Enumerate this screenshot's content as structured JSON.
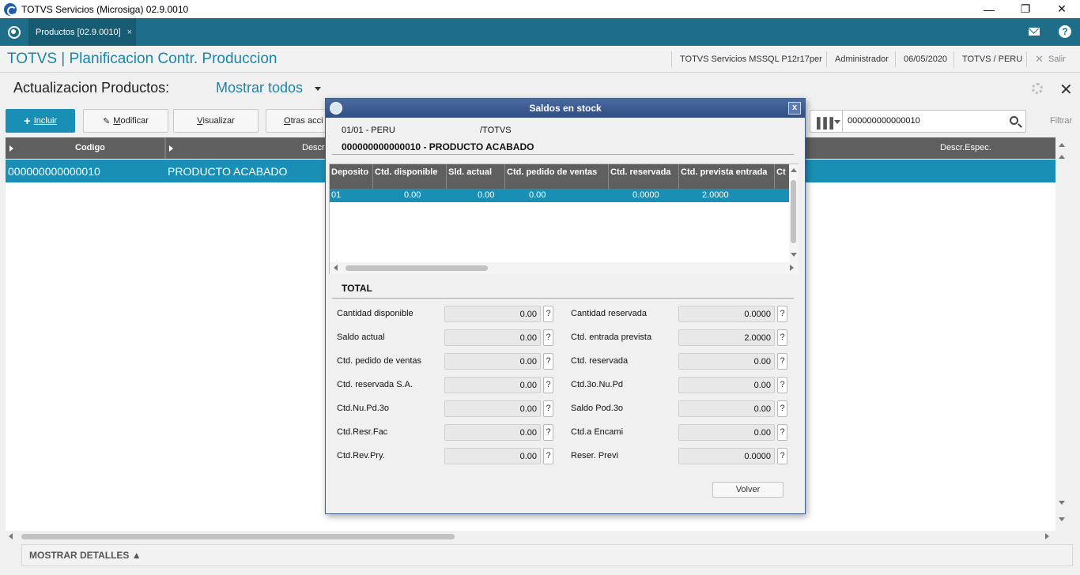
{
  "window": {
    "title": "TOTVS Servicios (Microsiga) 02.9.0010",
    "minimize": "—",
    "restore": "❐",
    "close": "✕"
  },
  "tabbar": {
    "tabs": [
      {
        "label": "Productos [02.9.0010]",
        "close": "×"
      }
    ],
    "help": "?"
  },
  "header": {
    "title": "TOTVS | Planificacion Contr. Produccion",
    "environment": "TOTVS Servicios MSSQL P12r17per",
    "user": "Administrador",
    "date": "06/05/2020",
    "company": "TOTVS / PERU",
    "exit_label": "Salir",
    "exit_icon": "✕"
  },
  "browse": {
    "title": "Actualizacion Productos:",
    "filter": "Mostrar todos",
    "close": "✕",
    "buttons": {
      "incluir": "Incluir",
      "modificar_first": "M",
      "modificar_rest": "odificar",
      "visualizar_first": "V",
      "visualizar_rest": "isualizar",
      "otras_first": "O",
      "otras_rest": "tras acci"
    },
    "search_value": "000000000000010",
    "filtrar": "Filtrar",
    "columns": [
      "Codigo",
      "Descr",
      "Descr.Espec."
    ],
    "rows": [
      {
        "codigo": "000000000000010",
        "descripcion": "PRODUCTO ACABADO"
      }
    ],
    "details": "MOSTRAR DETALLES ▲"
  },
  "dialog": {
    "title": "Saldos en stock",
    "close": "x",
    "filial": "01/01 - PERU",
    "empresa": "/TOTVS",
    "product": "000000000000010 - PRODUCTO ACABADO",
    "columns": [
      "Deposito",
      "Ctd. disponible",
      "Sld. actual",
      "Ctd. pedido de ventas",
      "Ctd. reservada",
      "Ctd. prevista entrada",
      "Ct"
    ],
    "rows": [
      {
        "deposito": "01",
        "disponible": "0.00",
        "actual": "0.00",
        "pedido": "0.00",
        "reservada": "0.0000",
        "prevista": "2.0000"
      }
    ],
    "total_label": "TOTAL",
    "fields_left": [
      {
        "label": "Cantidad disponible",
        "value": "0.00"
      },
      {
        "label": "Saldo actual",
        "value": "0.00"
      },
      {
        "label": "Ctd. pedido de ventas",
        "value": "0.00"
      },
      {
        "label": "Ctd. reservada S.A.",
        "value": "0.00"
      },
      {
        "label": "Ctd.Nu.Pd.3o",
        "value": "0.00"
      },
      {
        "label": "Ctd.Resr.Fac",
        "value": "0.00"
      },
      {
        "label": "Ctd.Rev.Pry.",
        "value": "0.00"
      }
    ],
    "fields_right": [
      {
        "label": "Cantidad reservada",
        "value": "0.0000"
      },
      {
        "label": "Ctd. entrada prevista",
        "value": "2.0000"
      },
      {
        "label": "Ctd. reservada",
        "value": "0.00"
      },
      {
        "label": "Ctd.3o.Nu.Pd",
        "value": "0.00"
      },
      {
        "label": "Saldo Pod.3o",
        "value": "0.00"
      },
      {
        "label": "Ctd.a Encami",
        "value": "0.00"
      },
      {
        "label": "Reser. Previ",
        "value": "0.0000"
      }
    ],
    "help_glyph": "?",
    "volver": "Volver"
  }
}
